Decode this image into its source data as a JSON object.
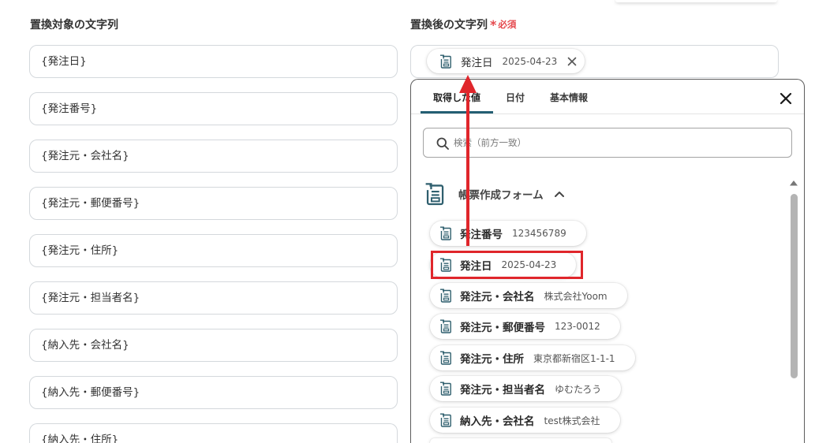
{
  "colors": {
    "annotation_red": "#e0262b",
    "required_red": "#e5484d",
    "tab_active": "#245f73",
    "icon": "#2f5f6e"
  },
  "left": {
    "heading": "置換対象の文字列",
    "fields": [
      {
        "value": "{発注日}"
      },
      {
        "value": "{発注番号}"
      },
      {
        "value": "{発注元・会社名}"
      },
      {
        "value": "{発注元・郵便番号}"
      },
      {
        "value": "{発注元・住所}"
      },
      {
        "value": "{発注元・担当者名}"
      },
      {
        "value": "{納入先・会社名}"
      },
      {
        "value": "{納入先・郵便番号}"
      },
      {
        "value": "{納入先・住所}"
      }
    ]
  },
  "right": {
    "heading": "置換後の文字列",
    "required_mark": "*",
    "required_label": "必須",
    "chip": {
      "icon": "form-document-icon",
      "label": "発注日",
      "value": "2025-04-23",
      "remove_icon": "close-icon"
    }
  },
  "picker": {
    "tabs": [
      {
        "label": "取得した値",
        "active": true
      },
      {
        "label": "日付",
        "active": false
      },
      {
        "label": "基本情報",
        "active": false
      }
    ],
    "close_icon": "close-icon",
    "search": {
      "icon": "search-icon",
      "placeholder": "検索（前方一致）"
    },
    "section": {
      "icon": "form-document-icon",
      "title": "帳票作成フォーム",
      "expanded": true,
      "toggle_icon": "chevron-up-icon"
    },
    "items": [
      {
        "label": "発注番号",
        "value": "123456789"
      },
      {
        "label": "発注日",
        "value": "2025-04-23",
        "highlighted": true
      },
      {
        "label": "発注元・会社名",
        "value": "株式会社Yoom"
      },
      {
        "label": "発注元・郵便番号",
        "value": "123-0012"
      },
      {
        "label": "発注元・住所",
        "value": "東京都新宿区1-1-1"
      },
      {
        "label": "発注元・担当者名",
        "value": "ゆむたろう"
      },
      {
        "label": "納入先・会社名",
        "value": "test株式会社"
      }
    ]
  }
}
